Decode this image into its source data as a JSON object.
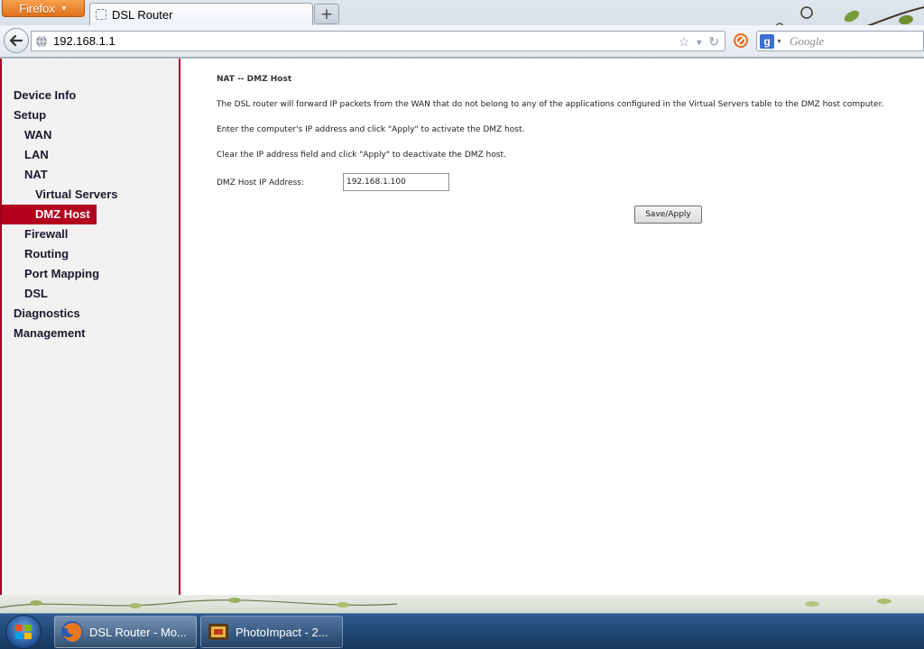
{
  "browser": {
    "app_button": "Firefox",
    "tab_title": "DSL Router",
    "url": "192.168.1.1",
    "search_placeholder": "Google"
  },
  "sidebar": {
    "items": [
      {
        "label": "Device Info"
      },
      {
        "label": "Setup"
      },
      {
        "label": "WAN"
      },
      {
        "label": "LAN"
      },
      {
        "label": "NAT"
      },
      {
        "label": "Virtual Servers"
      },
      {
        "label": "DMZ Host"
      },
      {
        "label": "Firewall"
      },
      {
        "label": "Routing"
      },
      {
        "label": "Port Mapping"
      },
      {
        "label": "DSL"
      },
      {
        "label": "Diagnostics"
      },
      {
        "label": "Management"
      }
    ]
  },
  "main": {
    "heading": "NAT -- DMZ Host",
    "paragraphs": [
      "The DSL router will forward IP packets from the WAN that do not belong to any of the applications configured in the Virtual Servers table to the DMZ host computer.",
      "Enter the computer's IP address and click \"Apply\" to activate the DMZ host.",
      "Clear the IP address field and click \"Apply\" to deactivate the DMZ host."
    ],
    "dmz_label": "DMZ Host IP Address:",
    "dmz_value": "192.168.1.100",
    "apply_label": "Save/Apply"
  },
  "taskbar": {
    "items": [
      {
        "label": "DSL Router - Mo..."
      },
      {
        "label": "PhotoImpact - 2..."
      }
    ]
  },
  "colors": {
    "accent": "#b3001e",
    "sidebar_border": "#a00020"
  }
}
